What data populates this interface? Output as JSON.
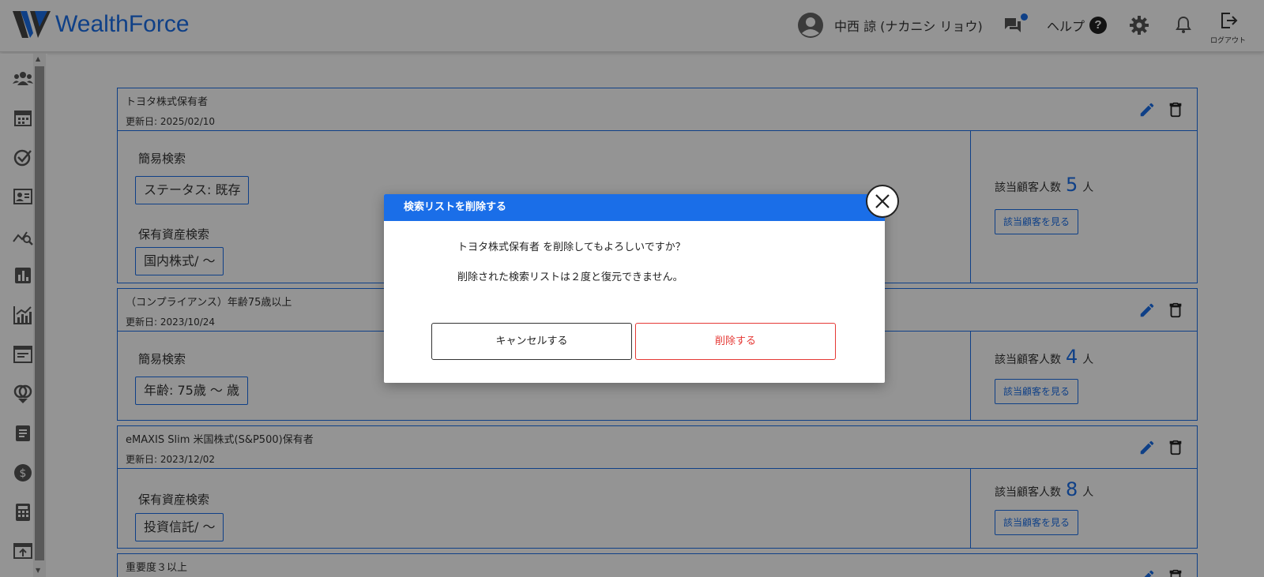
{
  "header": {
    "logo_text": "WealthForce",
    "user_name": "中西 諒 (ナカニシ リョウ)",
    "help_label": "ヘルプ",
    "help_icon_char": "?",
    "logout_label": "ログアウト",
    "brand_color": "#1a6ee8"
  },
  "sidebar": {
    "items": [
      "customers-icon",
      "calendar-icon",
      "check-circle-icon",
      "contact-card-icon",
      "analytics-search-icon",
      "bar-chart-icon",
      "growth-chart-icon",
      "news-icon",
      "ring-link-icon",
      "document-icon",
      "dollar-icon",
      "calculator-icon",
      "upload-screen-icon"
    ]
  },
  "cards": [
    {
      "title": "トヨタ株式保有者",
      "updated": "更新日: 2025/02/10",
      "sections": [
        {
          "label": "簡易検索",
          "chip": "ステータス: 既存"
        },
        {
          "label": "保有資産検索",
          "chip": "国内株式/ 〜"
        }
      ],
      "count_label": "該当顧客人数",
      "count": "5",
      "count_unit": "人",
      "view_button": "該当顧客を見る"
    },
    {
      "title": "（コンプライアンス）年齢75歳以上",
      "updated": "更新日: 2023/10/24",
      "sections": [
        {
          "label": "簡易検索",
          "chip": "年齢: 75歳 〜 歳"
        }
      ],
      "count_label": "該当顧客人数",
      "count": "4",
      "count_unit": "人",
      "view_button": "該当顧客を見る"
    },
    {
      "title": "eMAXIS Slim 米国株式(S&P500)保有者",
      "updated": "更新日: 2023/12/02",
      "sections": [
        {
          "label": "保有資産検索",
          "chip": "投資信託/ 〜"
        }
      ],
      "count_label": "該当顧客人数",
      "count": "8",
      "count_unit": "人",
      "view_button": "該当顧客を見る"
    },
    {
      "title": "重要度３以上"
    }
  ],
  "modal": {
    "title": "検索リストを削除する",
    "message1": "トヨタ株式保有者 を削除してもよろしいですか？",
    "message2": "削除された検索リストは２度と復元できません。",
    "cancel_label": "キャンセルする",
    "delete_label": "削除する"
  }
}
